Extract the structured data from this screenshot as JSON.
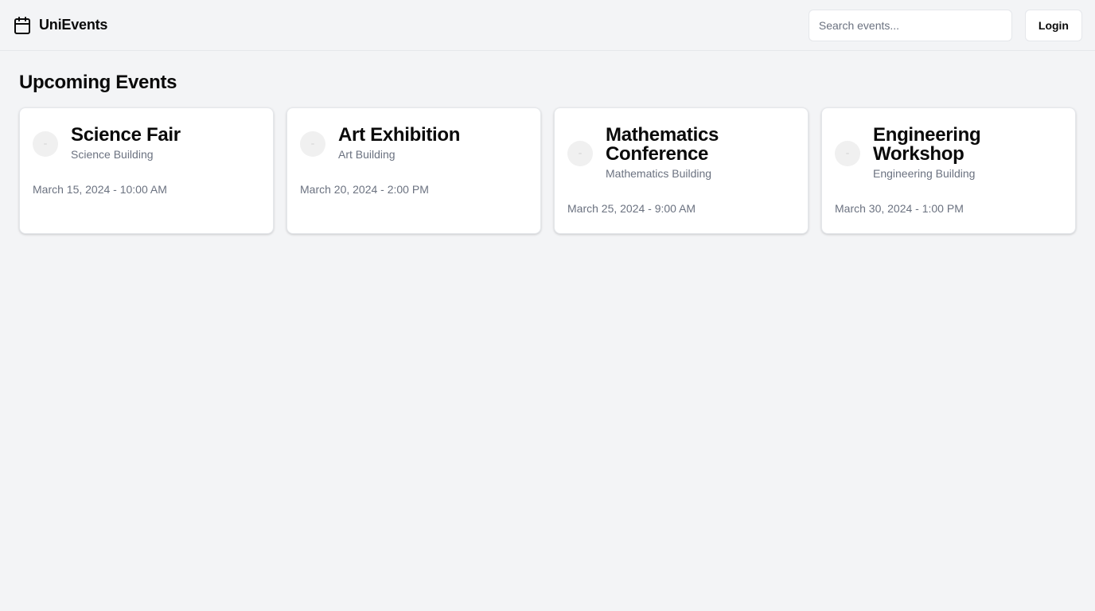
{
  "header": {
    "brand_icon": "calendar-icon",
    "brand_name": "UniEvents",
    "search_placeholder": "Search events...",
    "login_label": "Login"
  },
  "main": {
    "title": "Upcoming Events",
    "events": [
      {
        "title": "Science Fair",
        "location": "Science Building",
        "date": "March 15, 2024 - 10:00 AM"
      },
      {
        "title": "Art Exhibition",
        "location": "Art Building",
        "date": "March 20, 2024 - 2:00 PM"
      },
      {
        "title": "Mathematics Conference",
        "location": "Mathematics Building",
        "date": "March 25, 2024 - 9:00 AM"
      },
      {
        "title": "Engineering Workshop",
        "location": "Engineering Building",
        "date": "March 30, 2024 - 1:00 PM"
      }
    ]
  },
  "colors": {
    "background": "#f3f4f6",
    "card": "#ffffff",
    "text": "#0a0a0a",
    "muted": "#6b7280",
    "border": "#e5e7eb"
  }
}
